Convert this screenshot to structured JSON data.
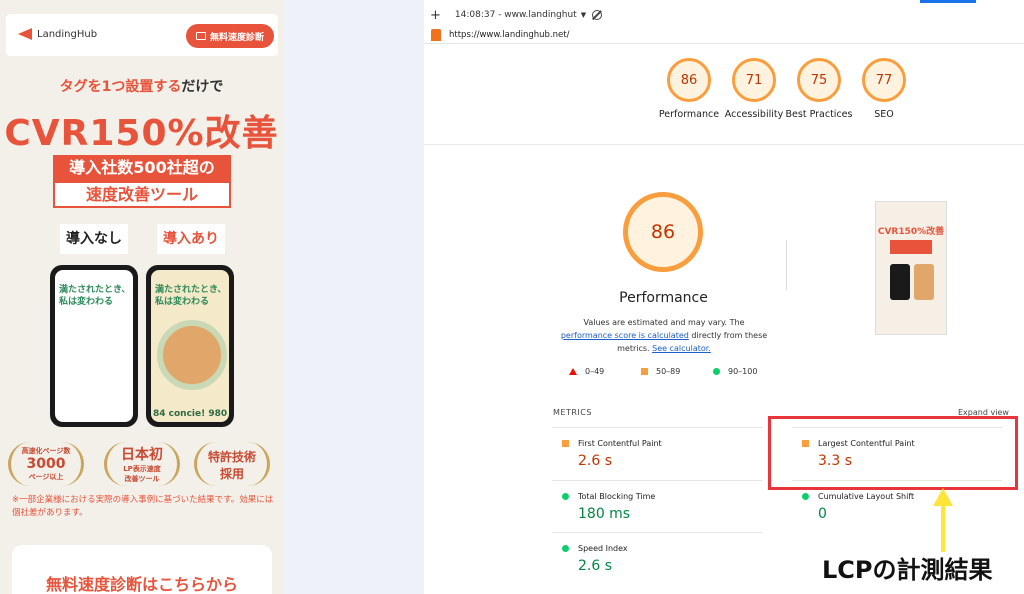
{
  "landing": {
    "logo_text": "LandingHub",
    "header_button": "無料速度診断",
    "tag_prefix": "タグを1つ設置する",
    "tag_suffix": "だけで",
    "cvr": "CVR150%改善",
    "cvr_mark": "※",
    "box_red": "導入社数500社超の",
    "box_white": "速度改善ツール",
    "before_label": "導入なし",
    "after_label": "導入あり",
    "phone_text_l1": "満たされたとき、",
    "phone_text_l2": "私は変わわる",
    "phone_foot": "84 concie! 980",
    "badge1": {
      "small_top": "高速化ページ数",
      "big": "3000",
      "small_bottom": "ページ以上"
    },
    "badge2": {
      "big": "日本初",
      "small_top": "LP表示速度",
      "small_bottom": "改善ツール"
    },
    "badge3": {
      "line1": "特許技術",
      "line2": "採用"
    },
    "note": "※一部企業様における実際の導入事例に基づいた結果です。効果には個社差があります。",
    "cta": "無料速度診断はこちらから"
  },
  "browser": {
    "time": "14:08:37 - www.landinghut",
    "url": "https://www.landinghub.net/"
  },
  "categories": [
    {
      "score": "86",
      "label": "Performance"
    },
    {
      "score": "71",
      "label": "Accessibility"
    },
    {
      "score": "75",
      "label": "Best Practices"
    },
    {
      "score": "77",
      "label": "SEO"
    }
  ],
  "performance": {
    "score": "86",
    "label": "Performance",
    "desc_1": "Values are estimated and may vary. The ",
    "desc_link1": "performance score is calculated",
    "desc_2": " directly from these metrics. ",
    "desc_link2": "See calculator."
  },
  "legend": {
    "bad": "0–49",
    "avg": "50–89",
    "good": "90–100"
  },
  "metrics_title": "METRICS",
  "expand_view": "Expand view",
  "metrics": [
    {
      "name": "First Contentful Paint",
      "value": "2.6 s",
      "status": "average"
    },
    {
      "name": "Largest Contentful Paint",
      "value": "3.3 s",
      "status": "average"
    },
    {
      "name": "Total Blocking Time",
      "value": "180 ms",
      "status": "good"
    },
    {
      "name": "Cumulative Layout Shift",
      "value": "0",
      "status": "good"
    },
    {
      "name": "Speed Index",
      "value": "2.6 s",
      "status": "good"
    }
  ],
  "thumb_cvr": "CVR150%改善",
  "caption": "LCPの計測結果",
  "colors": {
    "accent": "#e8543b",
    "orange": "#fa9e3d",
    "green": "#0cce6b",
    "highlight": "#e8343b",
    "arrow": "#ffe53b"
  }
}
